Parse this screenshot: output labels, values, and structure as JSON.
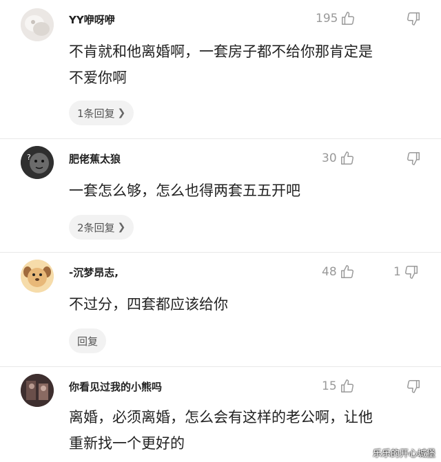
{
  "comments": [
    {
      "username": "YY咿呀咿",
      "likes": "195",
      "dislikes": "",
      "text": "不肯就和他离婚啊，一套房子都不给你那肯定是\n不爱你啊",
      "reply_label": "1条回复",
      "has_chevron": true,
      "avatar": "white-fluffy-avatar"
    },
    {
      "username": "肥佬蕉太狼",
      "likes": "30",
      "dislikes": "",
      "text": "一套怎么够，怎么也得两套五五开吧",
      "reply_label": "2条回复",
      "has_chevron": true,
      "avatar": "dark-meme-avatar"
    },
    {
      "username": "-沉梦昂志,",
      "likes": "48",
      "dislikes": "1",
      "text": "不过分，四套都应该给你",
      "reply_label": "回复",
      "has_chevron": false,
      "avatar": "dog-face-avatar"
    },
    {
      "username": "你看见过我的小熊吗",
      "likes": "15",
      "dislikes": "",
      "text": "离婚，必须离婚，怎么会有这样的老公啊，让他\n重新找一个更好的",
      "reply_label": "",
      "has_chevron": false,
      "avatar": "dark-photo-avatar"
    }
  ],
  "watermark": "乐乐的开心城堡",
  "colors": {
    "meta": "#999999",
    "text": "#222222",
    "pill": "#f2f2f2"
  }
}
